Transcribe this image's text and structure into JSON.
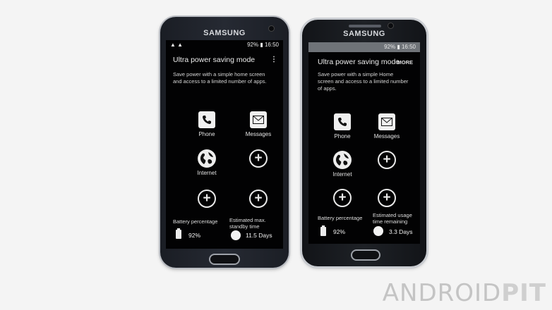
{
  "phones": [
    {
      "brand": "SAMSUNG",
      "status": {
        "left_icons": "▲ ▲",
        "battery": "92%",
        "time": "16:50"
      },
      "title": "Ultra power saving mode",
      "menu": "⋮",
      "description": "Save power with a simple home screen and access to a limited number of apps.",
      "apps": [
        {
          "label": "Phone",
          "icon": "phone-icon"
        },
        {
          "label": "Messages",
          "icon": "messages-icon"
        },
        {
          "label": "Internet",
          "icon": "globe-icon"
        },
        {
          "label": "",
          "icon": "add-icon"
        },
        {
          "label": "",
          "icon": "add-icon"
        },
        {
          "label": "",
          "icon": "add-icon"
        }
      ],
      "battery_label": "Battery percentage",
      "battery_value": "92%",
      "time_label": "Estimated max. standby time",
      "time_value": "11.5 Days"
    },
    {
      "brand": "SAMSUNG",
      "status": {
        "left_icons": "",
        "battery": "92%",
        "time": "16:50"
      },
      "title": "Ultra power saving mode",
      "menu": "MORE",
      "description": "Save power with a simple Home screen and access to a limited number of apps.",
      "apps": [
        {
          "label": "Phone",
          "icon": "phone-icon"
        },
        {
          "label": "Messages",
          "icon": "messages-icon"
        },
        {
          "label": "Internet",
          "icon": "globe-icon"
        },
        {
          "label": "",
          "icon": "add-icon"
        },
        {
          "label": "",
          "icon": "add-icon"
        },
        {
          "label": "",
          "icon": "add-icon"
        }
      ],
      "battery_label": "Battery percentage",
      "battery_value": "92%",
      "time_label": "Estimated usage time remaining",
      "time_value": "3.3 Days"
    }
  ],
  "watermark": {
    "part1": "ANDROID",
    "part2": "PIT"
  },
  "colors": {
    "background": "#f4f4f4",
    "screen": "#020203",
    "text": "#ececec"
  }
}
